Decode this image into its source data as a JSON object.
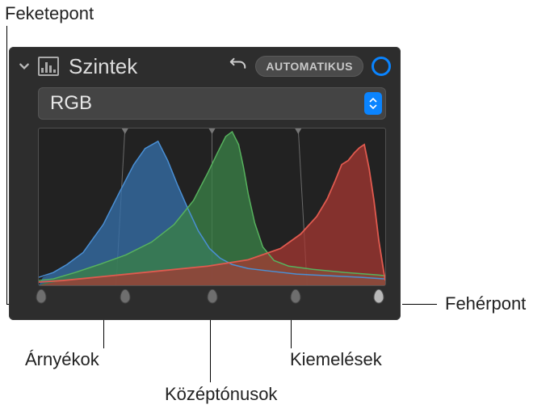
{
  "callouts": {
    "blackpoint": "Feketepont",
    "whitepoint": "Fehérpont",
    "shadows": "Árnyékok",
    "midtones": "Középtónusok",
    "highlights": "Kiemelések"
  },
  "panel": {
    "title": "Szintek",
    "auto_label": "AUTOMATIKUS",
    "channel_value": "RGB"
  },
  "handles": {
    "positions_pct": [
      1,
      25,
      50,
      74,
      98
    ]
  }
}
